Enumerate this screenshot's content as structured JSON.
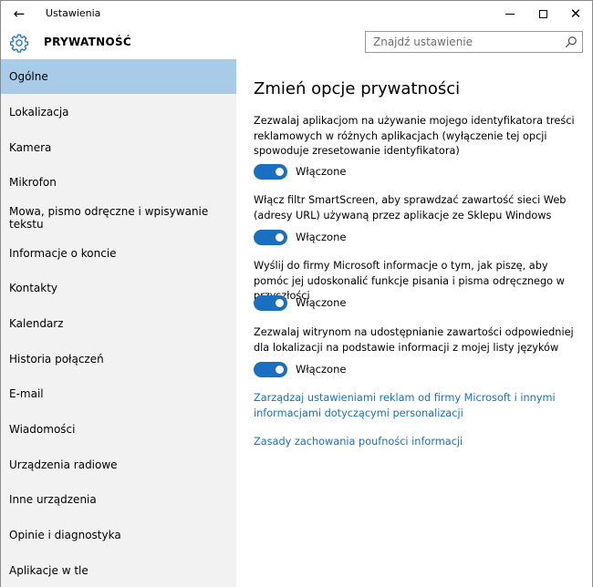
{
  "window": {
    "title": "Ustawienia",
    "back_icon": "back-arrow-icon",
    "minimize_icon": "minimize-icon",
    "maximize_icon": "maximize-icon",
    "close_icon": "close-icon"
  },
  "header": {
    "icon": "gear-icon",
    "title": "PRYWATNOŚĆ",
    "search": {
      "placeholder": "Znajdź ustawienie",
      "value": "",
      "icon": "search-icon"
    }
  },
  "sidebar": {
    "items": [
      {
        "label": "Ogólne",
        "active": true
      },
      {
        "label": "Lokalizacja"
      },
      {
        "label": "Kamera"
      },
      {
        "label": "Mikrofon"
      },
      {
        "label": "Mowa, pismo odręczne i wpisywanie tekstu"
      },
      {
        "label": "Informacje o koncie"
      },
      {
        "label": "Kontakty"
      },
      {
        "label": "Kalendarz"
      },
      {
        "label": "Historia połączeń"
      },
      {
        "label": "E-mail"
      },
      {
        "label": "Wiadomości"
      },
      {
        "label": "Urządzenia radiowe"
      },
      {
        "label": "Inne urządzenia"
      },
      {
        "label": "Opinie i diagnostyka"
      },
      {
        "label": "Aplikacje w tle"
      }
    ]
  },
  "main": {
    "title": "Zmień opcje prywatności",
    "settings": [
      {
        "description": "Zezwalaj aplikacjom na używanie mojego identyfikatora treści reklamowych w różnych aplikacjach (wyłączenie tej opcji spowoduje zresetowanie identyfikatora)",
        "state": "Włączone",
        "on": true
      },
      {
        "description": "Włącz filtr SmartScreen, aby sprawdzać zawartość sieci Web (adresy URL) używaną przez aplikacje ze Sklepu Windows",
        "state": "Włączone",
        "on": true
      },
      {
        "description": "Wyślij do firmy Microsoft informacje o tym, jak piszę, aby pomóc jej udoskonalić funkcje pisania i pisma odręcznego w przyszłości",
        "state": "Włączone",
        "on": true
      },
      {
        "description": "Zezwalaj witrynom na udostępnianie zawartości odpowiedniej dla lokalizacji na podstawie informacji z mojej listy języków",
        "state": "Włączone",
        "on": true
      }
    ],
    "links": [
      {
        "label": "Zarządzaj ustawieniami reklam od firmy Microsoft i innymi informacjami dotyczącymi personalizacji"
      },
      {
        "label": "Zasady zachowania poufności informacji"
      }
    ]
  },
  "colors": {
    "accent": "#1a6fc0",
    "sidebar_bg": "#f2f2f2",
    "sidebar_active": "#a8cbe8"
  }
}
